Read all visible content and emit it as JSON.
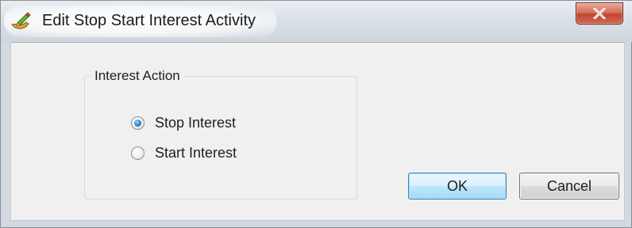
{
  "window": {
    "title": "Edit Stop Start Interest Activity",
    "icon": "edit-pencil-icon",
    "close_icon": "close-x-icon",
    "close_color": "#c7432d"
  },
  "group": {
    "legend": "Interest Action",
    "options": [
      {
        "label": "Stop Interest",
        "checked": true
      },
      {
        "label": "Start Interest",
        "checked": false
      }
    ]
  },
  "buttons": {
    "ok_label": "OK",
    "cancel_label": "Cancel"
  }
}
